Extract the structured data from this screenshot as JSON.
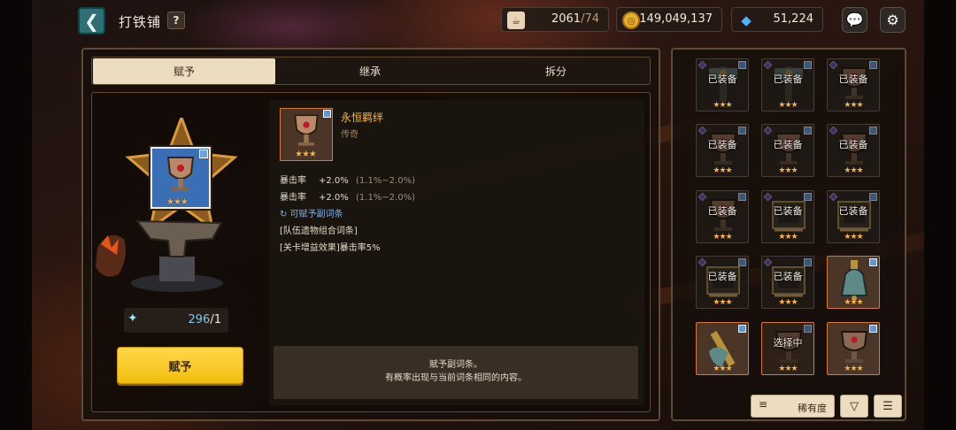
{
  "header": {
    "title": "打铁铺",
    "help": "?"
  },
  "resources": {
    "stamina_current": "2061",
    "stamina_max": "/74",
    "gold": "149,049,137",
    "gems": "51,224"
  },
  "tabs": [
    {
      "label": "赋予"
    },
    {
      "label": "继承"
    },
    {
      "label": "拆分"
    }
  ],
  "material": {
    "count": "296",
    "need": "/1"
  },
  "give_button": "赋予",
  "item": {
    "name": "永恒羁绊",
    "rarity": "传奇",
    "stars": "★★★"
  },
  "stats": [
    {
      "label": "暴击率",
      "value": "+2.0%",
      "range": "(1.1%~2.0%)"
    },
    {
      "label": "暴击率",
      "value": "+2.0%",
      "range": "(1.1%~2.0%)"
    }
  ],
  "rerollable": "可赋予副词条",
  "effects": [
    "[队伍遗物组合词条]",
    "[关卡增益效果]暴击率5%"
  ],
  "description": {
    "line1": "赋予副词条。",
    "line2": "有概率出现与当前词条相同的内容。"
  },
  "grid": {
    "equipped_label": "已装备",
    "selecting_label": "选择中",
    "stars": "★★★"
  },
  "sort": {
    "label": "稀有度"
  },
  "colors": {
    "accent_gold": "#f4b73c",
    "button_yellow": "#f2bd0e",
    "star": "#f6b445",
    "blue_badge": "#5f98d6"
  },
  "icons": [
    "back-icon",
    "coffee-icon",
    "gold-coin-icon",
    "gem-icon",
    "chat-icon",
    "gear-icon",
    "filter-icon",
    "sort-down-icon",
    "menu-icon"
  ]
}
